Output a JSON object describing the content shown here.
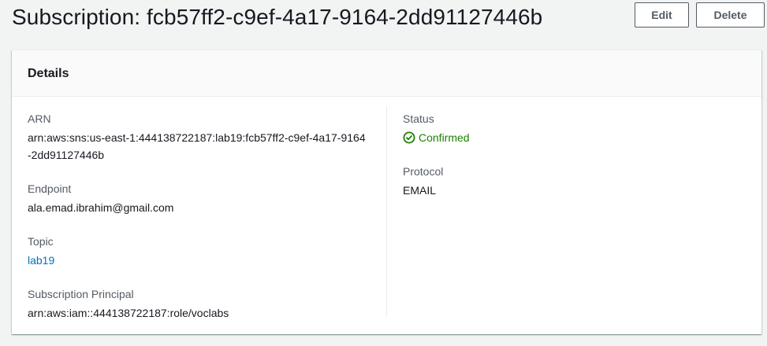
{
  "header": {
    "title": "Subscription: fcb57ff2-c9ef-4a17-9164-2dd91127446b",
    "edit_label": "Edit",
    "delete_label": "Delete"
  },
  "details": {
    "title": "Details",
    "arn": {
      "label": "ARN",
      "value": "arn:aws:sns:us-east-1:444138722187:lab19:fcb57ff2-c9ef-4a17-9164-2dd91127446b"
    },
    "endpoint": {
      "label": "Endpoint",
      "value": "ala.emad.ibrahim@gmail.com"
    },
    "topic": {
      "label": "Topic",
      "value": "lab19"
    },
    "subscription_principal": {
      "label": "Subscription Principal",
      "value": "arn:aws:iam::444138722187:role/voclabs"
    },
    "status": {
      "label": "Status",
      "value": "Confirmed",
      "icon": "check-circle-icon",
      "color": "#1d8102"
    },
    "protocol": {
      "label": "Protocol",
      "value": "EMAIL"
    }
  },
  "colors": {
    "link": "#0073bb",
    "text": "#16191f",
    "label": "#545b64",
    "background": "#f2f3f3"
  }
}
